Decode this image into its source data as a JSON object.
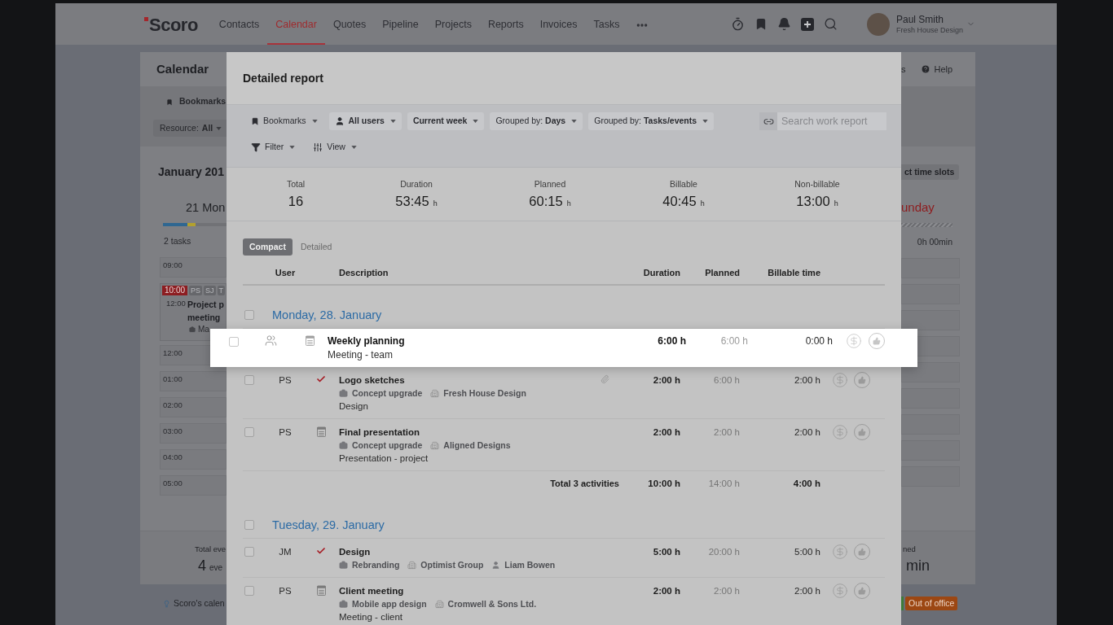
{
  "header": {
    "logo": "Scoro",
    "nav": [
      {
        "label": "Contacts",
        "selected": false
      },
      {
        "label": "Calendar",
        "selected": true
      },
      {
        "label": "Quotes",
        "selected": false
      },
      {
        "label": "Pipeline",
        "selected": false
      },
      {
        "label": "Projects",
        "selected": false
      },
      {
        "label": "Reports",
        "selected": false
      },
      {
        "label": "Invoices",
        "selected": false
      },
      {
        "label": "Tasks",
        "selected": false
      }
    ],
    "user": {
      "name": "Paul Smith",
      "company": "Fresh House Design"
    }
  },
  "calendar": {
    "title": "Calendar",
    "menu_fragment": "s",
    "help": "Help",
    "bookmarks": "Bookmarks",
    "resource": {
      "label": "Resource:",
      "value": "All"
    },
    "month": "January 201",
    "day": "21 Mon",
    "task_count": "2 tasks",
    "slots": [
      {
        "kind": "slot",
        "time": "09:00"
      },
      {
        "kind": "event",
        "start": "10:00",
        "end": "12:00",
        "people": [
          "PS",
          "SJ",
          "T"
        ],
        "title_lines": [
          "Project p",
          "meeting"
        ],
        "project": "Ma"
      },
      {
        "kind": "slot",
        "time": "12:00"
      },
      {
        "kind": "slot",
        "time": "01:00"
      },
      {
        "kind": "slot",
        "time": "02:00"
      },
      {
        "kind": "slot",
        "time": "03:00"
      },
      {
        "kind": "slot",
        "time": "04:00"
      },
      {
        "kind": "slot",
        "time": "05:00"
      }
    ],
    "slots_button": "ct time slots",
    "weekday": "unday",
    "hours": "0h 00min",
    "summary": [
      {
        "label": "Total eve",
        "value": "4",
        "unit": "eve"
      },
      {
        "label": "ned",
        "value": "min"
      }
    ],
    "tip": "Scoro's calen",
    "status_badge": "Out of office"
  },
  "report": {
    "title": "Detailed report",
    "toolbar": [
      {
        "kind": "bookmarks",
        "label": "Bookmarks"
      },
      {
        "kind": "users",
        "label": "All users"
      },
      {
        "kind": "period",
        "label": "Current week"
      },
      {
        "kind": "grouping",
        "label": "Grouped by: **Days**"
      },
      {
        "kind": "grouping",
        "label": "Grouped by: **Tasks/events**"
      }
    ],
    "view_controls": [
      {
        "kind": "filter",
        "label": "Filter"
      },
      {
        "kind": "view",
        "label": "View"
      }
    ],
    "search": {
      "placeholder": "Search work report"
    },
    "stats": [
      {
        "label": "Total",
        "value": "16"
      },
      {
        "label": "Duration",
        "value": "53:45",
        "unit": "h"
      },
      {
        "label": "Planned",
        "value": "60:15",
        "unit": "h"
      },
      {
        "label": "Billable",
        "value": "40:45",
        "unit": "h"
      },
      {
        "label": "Non-billable",
        "value": "13:00",
        "unit": "h"
      }
    ],
    "tabs": [
      {
        "label": "Compact",
        "selected": true
      },
      {
        "label": "Detailed",
        "selected": false
      }
    ],
    "columns": [
      "User",
      "Description",
      "Duration",
      "Planned",
      "Billable time"
    ],
    "groups": [
      {
        "date": "Monday, 28. January",
        "checked": false,
        "rows": [
          {
            "kind": "event",
            "team": true,
            "checked": false,
            "dragging": true,
            "attachment": false,
            "title": "Weekly planning",
            "note": "Meeting - team",
            "duration": "6:00 h",
            "planned": "6:00 h",
            "billable": "0:00 h"
          },
          {
            "kind": "task",
            "user": "PS",
            "team": false,
            "checked": false,
            "dragging": false,
            "attachment": true,
            "title": "Logo sketches",
            "tags": [
              {
                "kind": "project",
                "label": "Concept upgrade"
              },
              {
                "kind": "company",
                "label": "Fresh House Design"
              }
            ],
            "note": "Design",
            "duration": "2:00 h",
            "planned": "6:00 h",
            "billable": "2:00 h"
          },
          {
            "kind": "event",
            "user": "PS",
            "team": false,
            "checked": false,
            "dragging": false,
            "attachment": false,
            "title": "Final presentation",
            "tags": [
              {
                "kind": "project",
                "label": "Concept upgrade"
              },
              {
                "kind": "company",
                "label": "Aligned Designs"
              }
            ],
            "note": "Presentation - project",
            "duration": "2:00 h",
            "planned": "2:00 h",
            "billable": "2:00 h"
          }
        ],
        "total": {
          "label": "Total 3 activities",
          "duration": "10:00 h",
          "planned": "14:00 h",
          "billable": "4:00 h"
        }
      },
      {
        "date": "Tuesday, 29. January",
        "checked": false,
        "rows": [
          {
            "kind": "task",
            "user": "JM",
            "team": false,
            "checked": false,
            "dragging": false,
            "attachment": false,
            "title": "Design",
            "tags": [
              {
                "kind": "project",
                "label": "Rebranding"
              },
              {
                "kind": "company",
                "label": "Optimist Group"
              },
              {
                "kind": "person",
                "label": "Liam Bowen"
              }
            ],
            "duration": "5:00 h",
            "planned": "20:00 h",
            "billable": "5:00 h"
          },
          {
            "kind": "event",
            "user": "PS",
            "team": false,
            "checked": false,
            "dragging": false,
            "attachment": false,
            "title": "Client meeting",
            "tags": [
              {
                "kind": "project",
                "label": "Mobile app design"
              },
              {
                "kind": "company",
                "label": "Cromwell & Sons Ltd."
              }
            ],
            "note": "Meeting - client",
            "duration": "2:00 h",
            "planned": "2:00 h",
            "billable": "2:00 h"
          }
        ]
      }
    ]
  }
}
